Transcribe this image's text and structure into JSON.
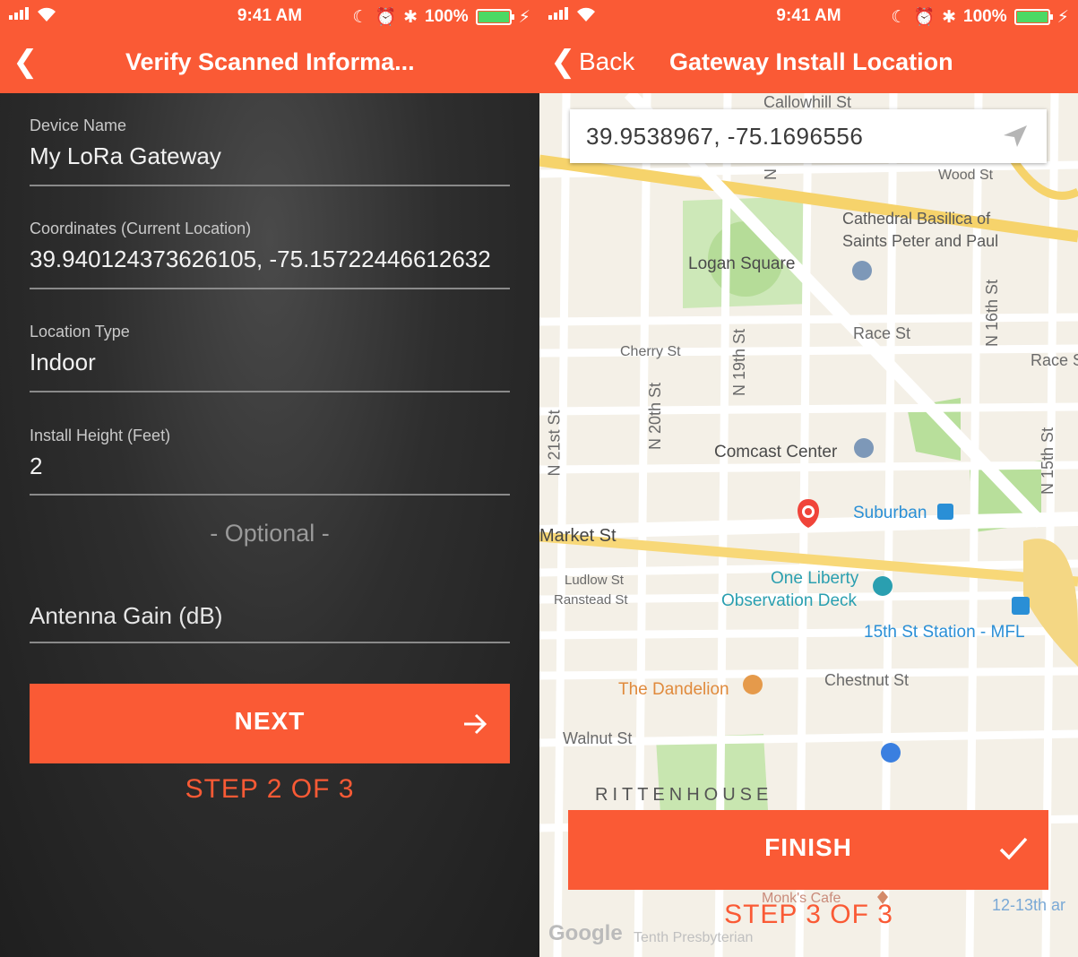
{
  "status_bar": {
    "time": "9:41 AM",
    "battery": "100%",
    "battery_level": 1.0
  },
  "verify_screen": {
    "title": "Verify Scanned Informa...",
    "fields": [
      {
        "label": "Device Name",
        "value": "My LoRa Gateway"
      },
      {
        "label": "Coordinates (Current Location)",
        "value": "39.940124373626105, -75.15722446612632"
      },
      {
        "label": "Location Type",
        "value": "Indoor"
      },
      {
        "label": "Install Height (Feet)",
        "value": "2"
      }
    ],
    "optional_label": "- Optional -",
    "antenna_placeholder": "Antenna Gain (dB)",
    "next_button": "NEXT",
    "step": "STEP 2 OF 3"
  },
  "location_screen": {
    "back_label": "Back",
    "title": "Gateway Install Location",
    "search_value": "39.9538967, -75.1696556",
    "finish_button": "FINISH",
    "step": "STEP 3 OF 3",
    "map": {
      "streets": [
        "Callowhill St",
        "Wood St",
        "Race St",
        "Race S",
        "Cherry St",
        "Market St",
        "Ludlow St",
        "Ranstead St",
        "Chestnut St",
        "Walnut St",
        "N 21st St",
        "N 20th St",
        "N 19th St",
        "N 16th St",
        "N 15th St",
        "N"
      ],
      "places": [
        {
          "name": "Logan Square",
          "color": "#4a4a4a"
        },
        {
          "name": "Cathedral Basilica of",
          "color": "#5a5a5a"
        },
        {
          "name": "Saints Peter and Paul",
          "color": "#5a5a5a"
        },
        {
          "name": "Comcast Center",
          "color": "#4a4a4a"
        },
        {
          "name": "Suburban",
          "color": "#2a8fd6"
        },
        {
          "name": "One Liberty",
          "color": "#2a9fb0"
        },
        {
          "name": "Observation Deck",
          "color": "#2a9fb0"
        },
        {
          "name": "15th St Station - MFL",
          "color": "#2a8fd6"
        },
        {
          "name": "The Dandelion",
          "color": "#e08a3c"
        },
        {
          "name": "RITTENHOUSE",
          "color": "#555555"
        },
        {
          "name": "Monk's Cafe",
          "color": "#c98b7a"
        },
        {
          "name": "12-13th ar",
          "color": "#7aa9d6"
        },
        {
          "name": "Google",
          "color": "#bbbbbb"
        },
        {
          "name": "Tenth Presbyterian",
          "color": "#c0c0c0"
        }
      ]
    }
  }
}
